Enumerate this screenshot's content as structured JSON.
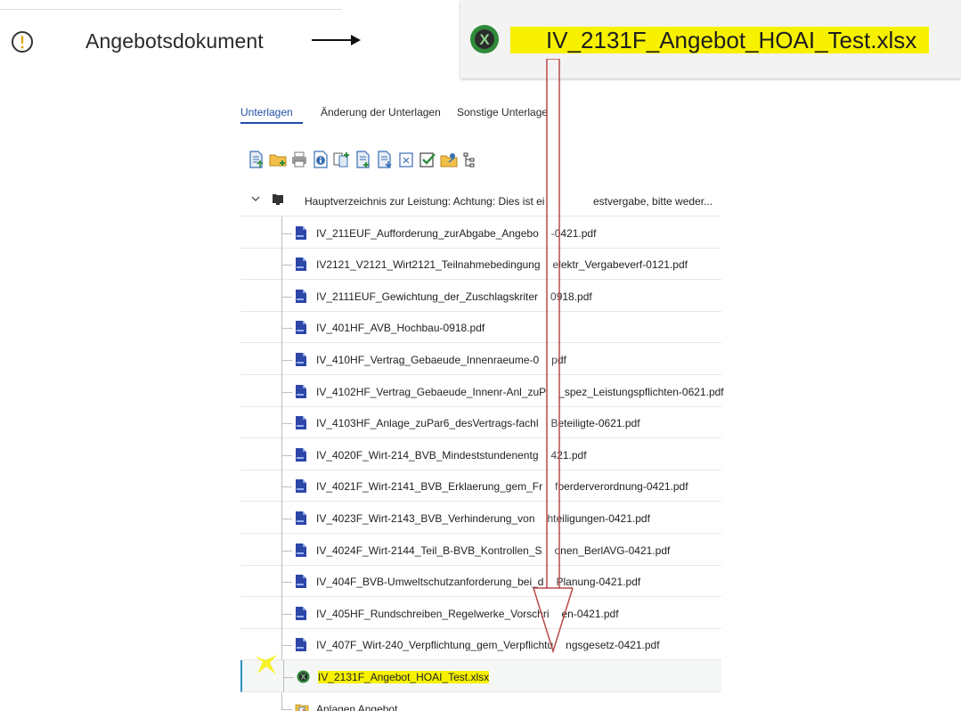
{
  "heading": {
    "icon": "warning-circle-icon",
    "title": "Angebotsdokument",
    "arrow_icon": "right-arrow-icon"
  },
  "file_chip": {
    "icon": "excel-icon",
    "filename": "IV_2131F_Angebot_HOAI_Test.xlsx",
    "highlight_color": "#f7f100"
  },
  "tabs": [
    {
      "label": "Unterlagen",
      "active": true
    },
    {
      "label": "Änderung der Unterlagen",
      "active": false
    },
    {
      "label": "Sonstige Unterlage",
      "active": false
    }
  ],
  "toolbar": [
    "upload-document-icon",
    "new-folder-icon",
    "print-icon",
    "info-icon",
    "compare-icon",
    "add-document-icon",
    "download-icon",
    "delete-icon",
    "approve-icon",
    "share-folder-icon",
    "tree-view-icon"
  ],
  "tree": {
    "root": {
      "icon": "folder-tree-icon",
      "expander": "chevron-down-icon",
      "label": "Hauptverzeichnis zur Leistung: Achtung: Dies ist ei",
      "label_hidden_tail": "estvergabe, bitte weder..."
    },
    "files": [
      {
        "a": "IV_211EUF_Aufforderung_zurAbgabe_Angebo",
        "b": "-0421.pdf",
        "icon": "pdf-icon"
      },
      {
        "a": "IV2121_V2121_Wirt2121_Teilnahmebedingung",
        "b": "elektr_Vergabeverf-0121.pdf",
        "icon": "pdf-icon"
      },
      {
        "a": "IV_2111EUF_Gewichtung_der_Zuschlagskriter",
        "b": "0918.pdf",
        "icon": "pdf-icon"
      },
      {
        "a": "IV_401HF_AVB_Hochbau-0918.pdf",
        "b": "",
        "icon": "pdf-icon"
      },
      {
        "a": "IV_410HF_Vertrag_Gebaeude_Innenraeume-0",
        "b": "pdf",
        "icon": "pdf-icon"
      },
      {
        "a": "IV_4102HF_Vertrag_Gebaeude_Innenr-Anl_zuP",
        "b": "_spez_Leistungspflichten-0621.pdf",
        "icon": "pdf-icon"
      },
      {
        "a": "IV_4103HF_Anlage_zuPar6_desVertrags-fachl",
        "b": "Beteiligte-0621.pdf",
        "icon": "pdf-icon"
      },
      {
        "a": "IV_4020F_Wirt-214_BVB_Mindeststundenentg",
        "b": "421.pdf",
        "icon": "pdf-icon"
      },
      {
        "a": "IV_4021F_Wirt-2141_BVB_Erklaerung_gem_Fr",
        "b": "foerderverordnung-0421.pdf",
        "icon": "pdf-icon"
      },
      {
        "a": "IV_4023F_Wirt-2143_BVB_Verhinderung_von",
        "b": "hteiligungen-0421.pdf",
        "icon": "pdf-icon"
      },
      {
        "a": "IV_4024F_Wirt-2144_Teil_B-BVB_Kontrollen_S",
        "b": "onen_BerlAVG-0421.pdf",
        "icon": "pdf-icon"
      },
      {
        "a": "IV_404F_BVB-Umweltschutzanforderung_bei_d",
        "b": "Planung-0421.pdf",
        "icon": "pdf-icon"
      },
      {
        "a": "IV_405HF_Rundschreiben_Regelwerke_Vorschri",
        "b": "en-0421.pdf",
        "icon": "pdf-icon"
      },
      {
        "a": "IV_407F_Wirt-240_Verpflichtung_gem_Verpflichtu",
        "b": "ngsgesetz-0421.pdf",
        "icon": "pdf-icon"
      }
    ],
    "selected_file": {
      "label": "IV_2131F_Angebot_HOAI_Test.xlsx",
      "icon": "excel-icon"
    },
    "attachments": {
      "label": "Anlagen Angebot",
      "icon": "attachment-folder-icon"
    }
  },
  "overlays": {
    "arrow": "down-arrow-icon",
    "arrow_color": "#b84a4a",
    "marker": "highlight-mark-icon",
    "marker_color": "#f7f100"
  }
}
